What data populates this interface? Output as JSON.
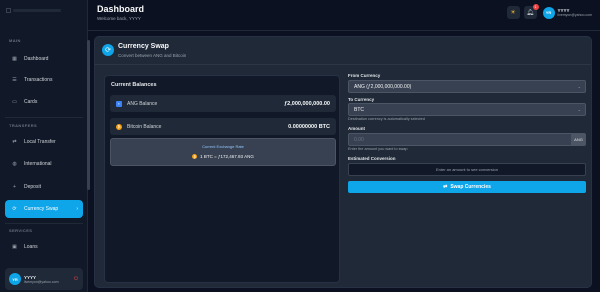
{
  "sidebar": {
    "sections": {
      "main": "MAIN",
      "transfers": "TRANSFERS",
      "services": "SERVICES"
    },
    "items": [
      {
        "label": "Dashboard",
        "icon": "grid-icon"
      },
      {
        "label": "Transactions",
        "icon": "list-icon"
      },
      {
        "label": "Cards",
        "icon": "card-icon"
      },
      {
        "label": "Local Transfer",
        "icon": "transfer-icon"
      },
      {
        "label": "International",
        "icon": "globe-icon"
      },
      {
        "label": "Deposit",
        "icon": "deposit-icon"
      },
      {
        "label": "Currency Swap",
        "icon": "swap-icon"
      },
      {
        "label": "Loans",
        "icon": "loan-icon"
      }
    ],
    "active_arrow": "›",
    "user": {
      "initials": "YR",
      "name": "YYYY",
      "email": "livemyon@yahoo.com"
    }
  },
  "header": {
    "title": "Dashboard",
    "subtitle": "Welcome back, YYYY",
    "notifications_count": "1",
    "user": {
      "initials": "YR",
      "name": "YYYY",
      "email": "livemyon@yahoo.com"
    }
  },
  "swap": {
    "title": "Currency Swap",
    "subtitle": "Convert between ANG and Bitcoin",
    "balances_title": "Current Balances",
    "ang_label": "ANG Balance",
    "ang_value": "ƒ2,000,000,000.00",
    "btc_label": "Bitcoin Balance",
    "btc_value": "0.00000000 BTC",
    "rate_title": "Current Exchange Rate",
    "rate_value": "1 BTC = ƒ172,467.93 ANG",
    "from_label": "From Currency",
    "from_value": "ANG (ƒ2,000,000,000.00)",
    "to_label": "To Currency",
    "to_value": "BTC",
    "to_hint": "Destination currency is automatically selected",
    "amount_label": "Amount",
    "amount_placeholder": "0.00",
    "amount_unit": "ANG",
    "amount_hint": "Enter the amount you want to swap",
    "estimated_label": "Estimated Conversion",
    "estimated_text": "Enter an amount to see conversion",
    "button_label": "Swap Currencies"
  },
  "colors": {
    "accent": "#0ea5e9",
    "background": "#0b1120",
    "panel": "#1f2937"
  }
}
